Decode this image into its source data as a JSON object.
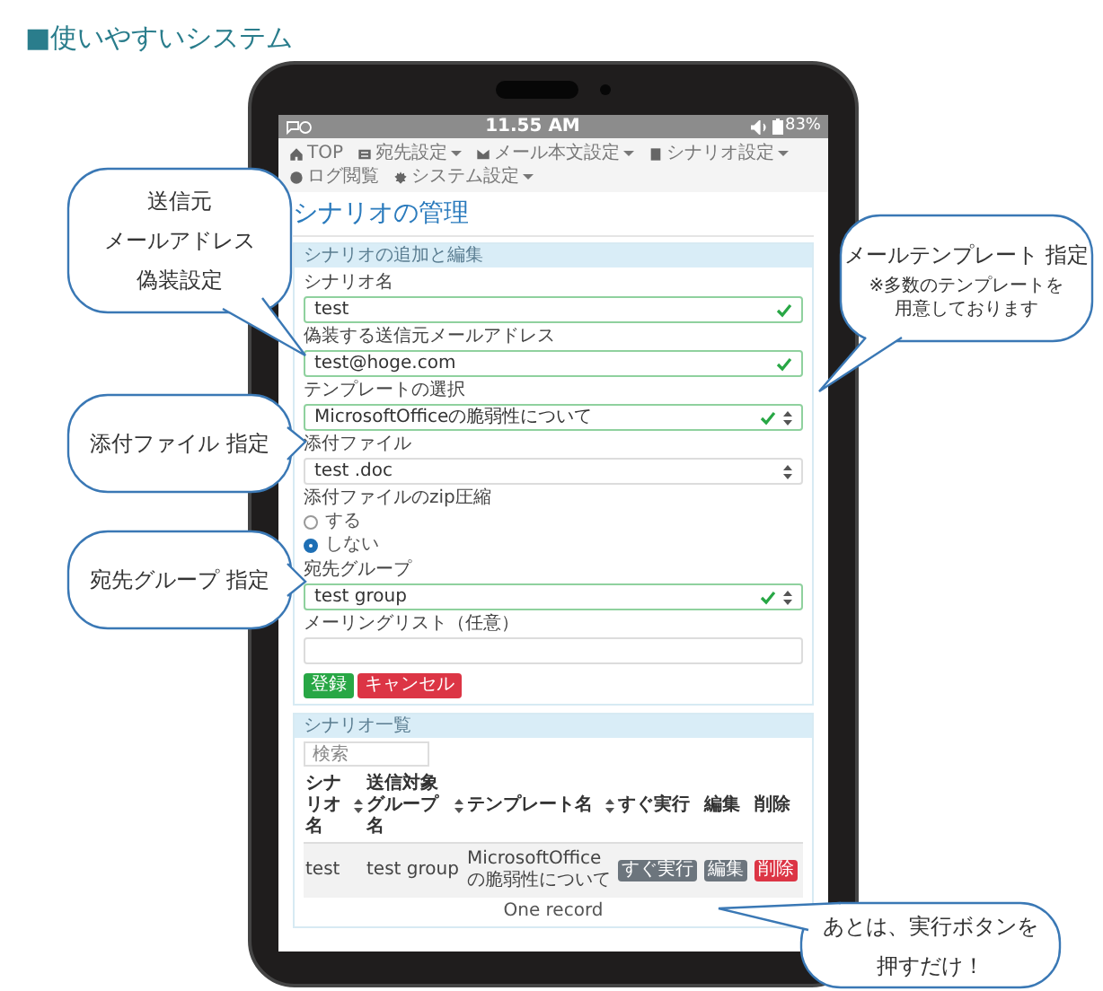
{
  "heading": "■使いやすいシステム",
  "status_bar": {
    "time": "11.55 AM",
    "battery": "83%"
  },
  "nav": [
    {
      "label": "TOP",
      "dropdown": false
    },
    {
      "label": "宛先設定",
      "dropdown": true
    },
    {
      "label": "メール本文設定",
      "dropdown": true
    },
    {
      "label": "シナリオ設定",
      "dropdown": true
    },
    {
      "label": "ログ閲覧",
      "dropdown": false
    },
    {
      "label": "システム設定",
      "dropdown": true
    }
  ],
  "page_title": "シナリオの管理",
  "form_panel": {
    "title": "シナリオの追加と編集",
    "fields": [
      {
        "kind": "text",
        "label": "シナリオ名",
        "value": "test",
        "valid": true
      },
      {
        "kind": "text",
        "label": "偽装する送信元メールアドレス",
        "value": "test@hoge.com",
        "valid": true
      },
      {
        "kind": "select",
        "label": "テンプレートの選択",
        "value": "MicrosoftOfficeの脆弱性について",
        "valid": true
      },
      {
        "kind": "select",
        "label": "添付ファイル",
        "value": "test .doc",
        "valid": false
      },
      {
        "kind": "radio",
        "label": "添付ファイルのzip圧縮",
        "options": [
          {
            "label": "する",
            "selected": false
          },
          {
            "label": "しない",
            "selected": true
          }
        ]
      },
      {
        "kind": "select",
        "label": "宛先グループ",
        "value": "test group",
        "valid": true
      },
      {
        "kind": "text",
        "label": "メーリングリスト（任意）",
        "valid": false
      }
    ],
    "buttons": [
      {
        "label": "登録",
        "kind": "submit"
      },
      {
        "label": "キャンセル",
        "kind": "cancel"
      }
    ]
  },
  "list_panel": {
    "title": "シナリオ一覧",
    "search": {
      "placeholder": "検索"
    },
    "columns": [
      {
        "label": "シナリオ名",
        "sortable": true
      },
      {
        "label": "送信対象グループ名",
        "sortable": true
      },
      {
        "label": "テンプレート名",
        "sortable": true
      },
      {
        "label": "すぐ実行",
        "sortable": false
      },
      {
        "label": "編集",
        "sortable": false
      },
      {
        "label": "削除",
        "sortable": false
      }
    ],
    "rows": [
      {
        "cells": [
          {
            "kind": "text",
            "text": "test"
          },
          {
            "kind": "text",
            "text": "test group"
          },
          {
            "kind": "text",
            "text": "MicrosoftOfficeの脆弱性について"
          },
          {
            "kind": "run",
            "text": "すぐ実行"
          },
          {
            "kind": "edit",
            "text": "編集"
          },
          {
            "kind": "delete",
            "text": "削除"
          }
        ]
      }
    ],
    "footer": "One record"
  },
  "callouts": [
    {
      "lines": [
        "送信元",
        "メールアドレス",
        "偽装設定"
      ]
    },
    {
      "lines": [
        "添付ファイル 指定"
      ]
    },
    {
      "lines": [
        "宛先グループ 指定"
      ]
    },
    {
      "lines": [
        "メールテンプレート 指定"
      ],
      "note": [
        "※多数のテンプレートを",
        "用意しております"
      ]
    },
    {
      "lines": [
        "あとは、実行ボタンを",
        "押すだけ！"
      ]
    }
  ]
}
